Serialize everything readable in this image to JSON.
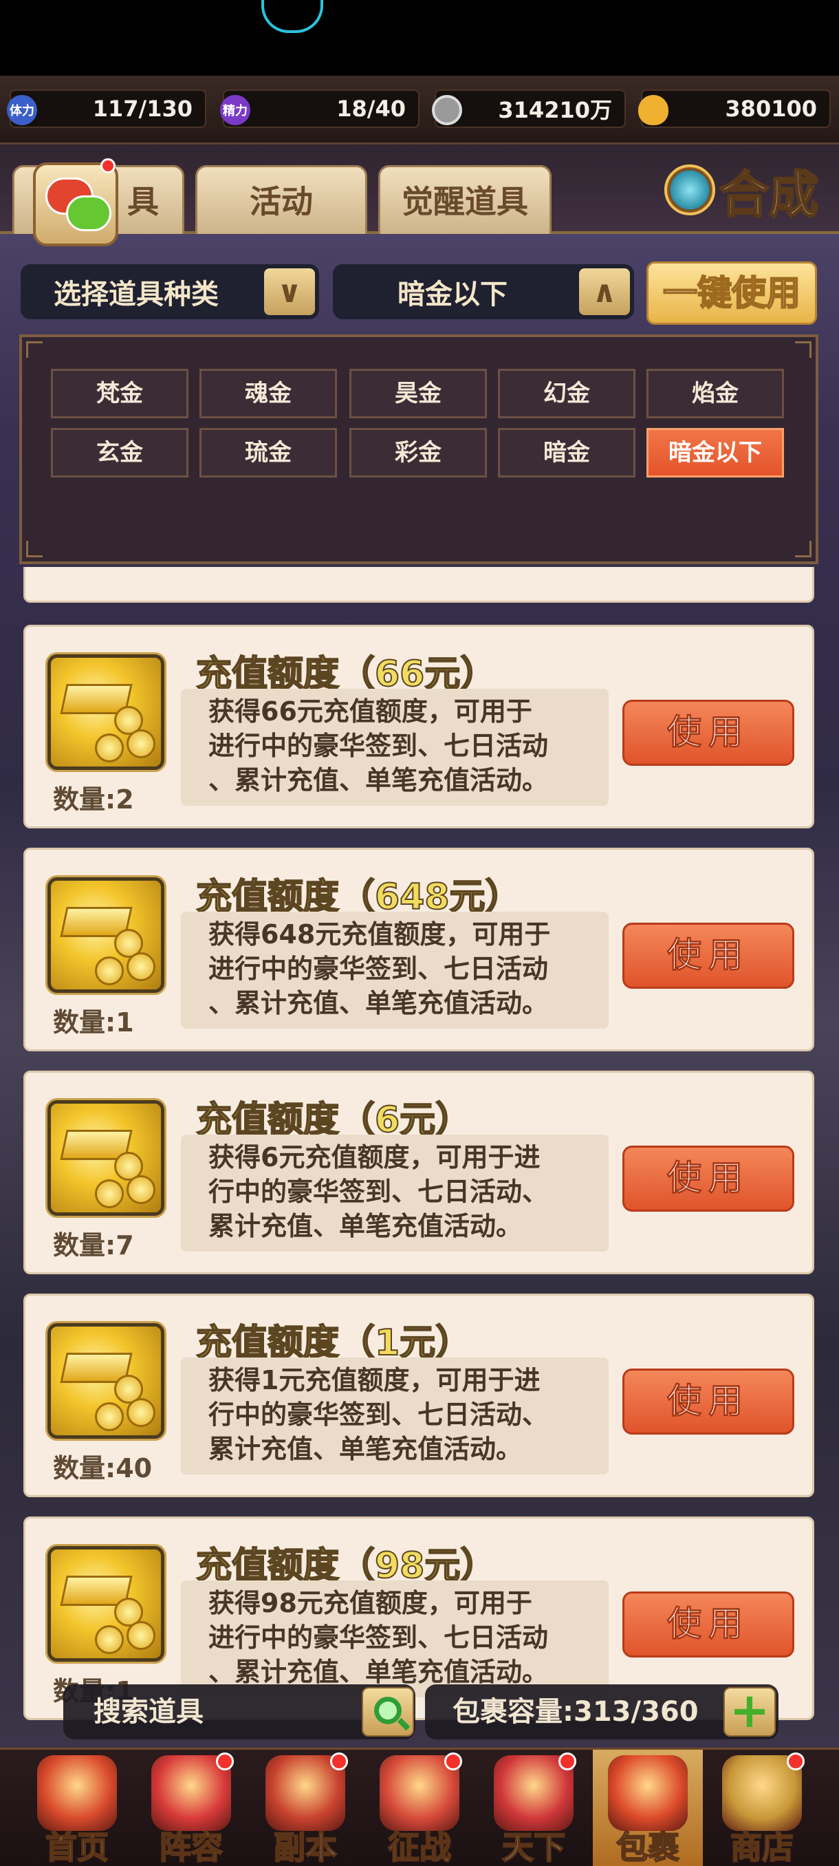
{
  "resources": [
    {
      "icon": "体力",
      "value": "117/130",
      "color": "#3a5fc8"
    },
    {
      "icon": "精力",
      "value": "18/40",
      "color": "#7a3ac8"
    },
    {
      "icon": "coin-icon",
      "value": "314210万",
      "color": "#b8b8b8"
    },
    {
      "icon": "gold-ingot-icon",
      "value": "380100",
      "color": "#f0b030"
    }
  ],
  "tabs": [
    "具",
    "活动",
    "觉醒道具"
  ],
  "hecheng_label": "合成",
  "filter": {
    "type_label": "选择道具种类",
    "grade_label": "暗金以下",
    "onekey_label": "一键使用"
  },
  "grade_options": [
    "梵金",
    "魂金",
    "昊金",
    "幻金",
    "焰金",
    "玄金",
    "琉金",
    "彩金",
    "暗金",
    "暗金以下"
  ],
  "selected_grade": "暗金以下",
  "items": [
    {
      "title": "充值额度（66元）",
      "desc": [
        "获得66元充值额度，可用于",
        "进行中的豪华签到、七日活动",
        "、累计充值、单笔充值活动。"
      ],
      "qty": "数量:2",
      "use_label": "使用"
    },
    {
      "title": "充值额度（648元）",
      "desc": [
        "获得648元充值额度，可用于",
        "进行中的豪华签到、七日活动",
        "、累计充值、单笔充值活动。"
      ],
      "qty": "数量:1",
      "use_label": "使用"
    },
    {
      "title": "充值额度（6元）",
      "desc": [
        "获得6元充值额度，可用于进",
        "行中的豪华签到、七日活动、",
        "累计充值、单笔充值活动。"
      ],
      "qty": "数量:7",
      "use_label": "使用"
    },
    {
      "title": "充值额度（1元）",
      "desc": [
        "获得1元充值额度，可用于进",
        "行中的豪华签到、七日活动、",
        "累计充值、单笔充值活动。"
      ],
      "qty": "数量:40",
      "use_label": "使用"
    },
    {
      "title": "充值额度（98元）",
      "desc": [
        "获得98元充值额度，可用于",
        "进行中的豪华签到、七日活动",
        "、累计充值、单笔充值活动。"
      ],
      "qty": "数量:1",
      "use_label": "使用"
    }
  ],
  "search": {
    "placeholder": "搜索道具"
  },
  "capacity": "包裹容量:313/360",
  "nav": [
    {
      "label": "首页",
      "icon": "palace-icon",
      "color": "#d94a2c",
      "badge": false
    },
    {
      "label": "阵容",
      "icon": "scroll-icon",
      "color": "#d83a3a",
      "badge": true
    },
    {
      "label": "副本",
      "icon": "sword-icon",
      "color": "#c8422f",
      "badge": true
    },
    {
      "label": "征战",
      "icon": "target-icon",
      "color": "#d64a3a",
      "badge": true
    },
    {
      "label": "天下",
      "icon": "banner-icon",
      "color": "#d0373a",
      "badge": true
    },
    {
      "label": "包裹",
      "icon": "bag-icon",
      "color": "#dc4a2a",
      "badge": false
    },
    {
      "label": "商店",
      "icon": "coins-icon",
      "color": "#c89838",
      "badge": true
    }
  ]
}
